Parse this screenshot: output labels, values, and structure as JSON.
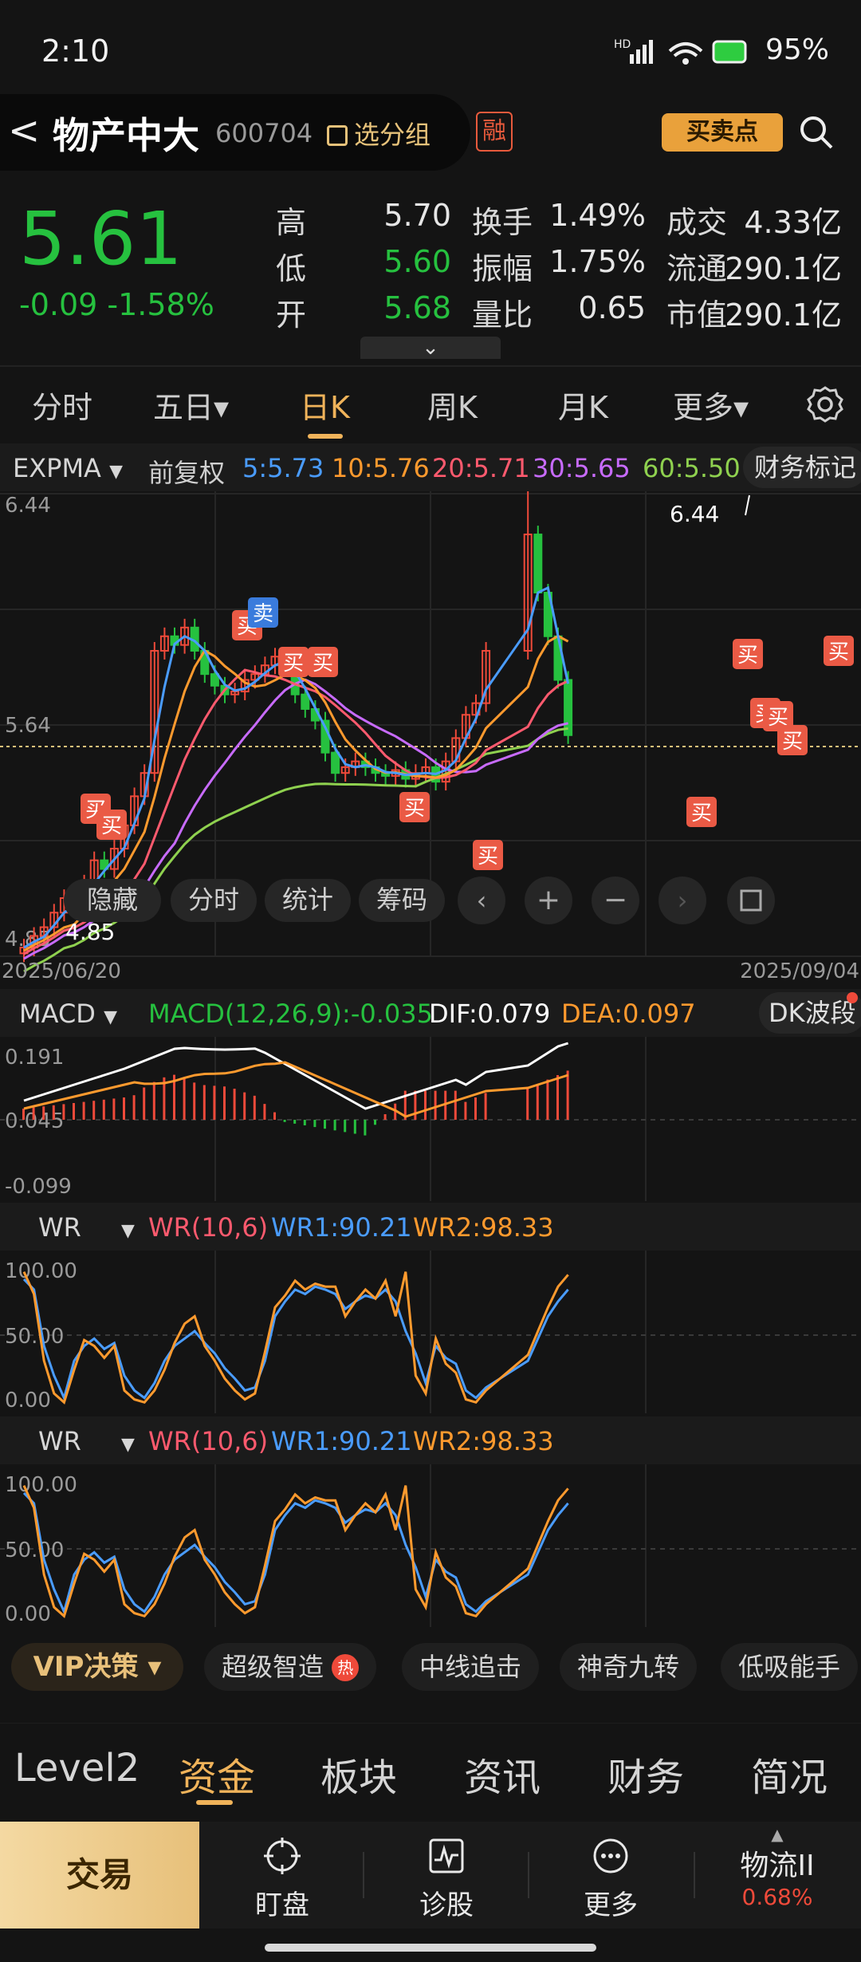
{
  "status": {
    "time": "2:10",
    "battery": "95%",
    "signal_badge": "HD"
  },
  "header": {
    "back_glyph": "<",
    "name": "物产中大",
    "code": "600704",
    "pick_group": "选分组",
    "margin_badge": "融",
    "buysell_button": "买卖点"
  },
  "quote": {
    "price": "5.61",
    "change": "-0.09  -1.58%",
    "rows": [
      {
        "l1": "高",
        "v1": "5.70",
        "l2": "换手",
        "v2": "1.49%",
        "l3": "成交",
        "v3": "4.33亿"
      },
      {
        "l1": "低",
        "v1": "5.60",
        "l2": "振幅",
        "v2": "1.75%",
        "l3": "流通",
        "v3": "290.1亿"
      },
      {
        "l1": "开",
        "v1": "5.68",
        "l2": "量比",
        "v2": "0.65",
        "l3": "市值",
        "v3": "290.1亿"
      }
    ],
    "expand_glyph": "⌄"
  },
  "tabs": [
    "分时",
    "五日▾",
    "日K",
    "周K",
    "月K",
    "更多▾"
  ],
  "kline": {
    "indicator": "EXPMA",
    "adjust": "前复权",
    "ma": [
      {
        "label": "5:5.73",
        "color": "#4a9cff"
      },
      {
        "label": "10:5.76",
        "color": "#ff9a2e"
      },
      {
        "label": "20:5.71",
        "color": "#ff5a6e"
      },
      {
        "label": "30:5.65",
        "color": "#c86bff"
      },
      {
        "label": "60:5.50",
        "color": "#8fd14f"
      }
    ],
    "finance_mark": "财务标记",
    "y_top": "6.44",
    "y_mid": "5.64",
    "y_bottom": "4.85",
    "high_label": "6.44",
    "low_label": "4.85",
    "date_start": "2025/06/20",
    "date_end": "2025/09/04",
    "buy": "买",
    "sell": "卖",
    "buttons": [
      "隐藏",
      "分时",
      "统计",
      "筹码"
    ]
  },
  "macd": {
    "indicator": "MACD",
    "params": "MACD(12,26,9):-0.035",
    "dif": "DIF:0.079",
    "dea": "DEA:0.097",
    "extra": "DK波段",
    "y_top": "0.191",
    "y_mid": "0.045",
    "y_bottom": "-0.099"
  },
  "wr": {
    "indicator": "WR",
    "params": "WR(10,6)",
    "wr1": "WR1:90.21",
    "wr2": "WR2:98.33",
    "y_top": "100.00",
    "y_mid": "50.00",
    "y_bottom": "0.00"
  },
  "strategies": {
    "vip": "VIP决策 ▾",
    "chips": [
      "超级智造",
      "中线追击",
      "神奇九转",
      "低吸能手"
    ],
    "hot": "热"
  },
  "subnav": [
    "Level2",
    "资金",
    "板块",
    "资讯",
    "财务",
    "简况"
  ],
  "bottom": {
    "trade": "交易",
    "items": [
      "盯盘",
      "诊股",
      "更多"
    ],
    "sector_name": "物流II",
    "sector_change": "0.68%"
  },
  "colors": {
    "up": "#ef4a3a",
    "down": "#26c13f",
    "accent": "#f0b35a"
  }
}
